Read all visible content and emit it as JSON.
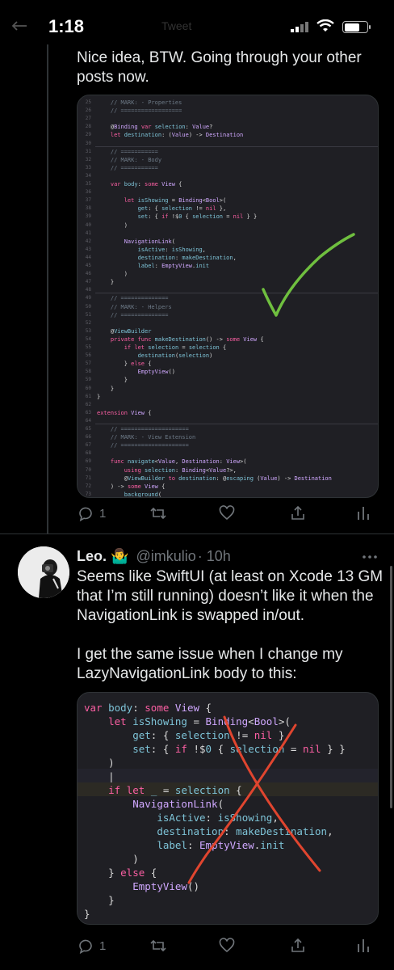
{
  "status_bar": {
    "time": "1:18",
    "ghost_label": "Tweet"
  },
  "tweet1": {
    "text_lines": [
      "Nice idea, BTW. Going through your other",
      "posts now."
    ],
    "image_alt": "Xcode screenshot of LazyNavigationLink code with a green checkmark",
    "code_lines": [
      {
        "n": "25",
        "t": "    // MARK: - Properties",
        "c": "cm"
      },
      {
        "n": "26",
        "t": "    // ==================",
        "c": "cm"
      },
      {
        "n": "27",
        "t": "",
        "c": "pl"
      },
      {
        "n": "28",
        "t": "    @Binding var selection: Value?",
        "c": "mix1"
      },
      {
        "n": "29",
        "t": "    let destination: (Value) -> Destination",
        "c": "mix2"
      },
      {
        "n": "30",
        "t": "",
        "c": "pl"
      },
      {
        "n": "31",
        "t": "    // ===========",
        "c": "cm"
      },
      {
        "n": "32",
        "t": "    // MARK: - Body",
        "c": "cm"
      },
      {
        "n": "33",
        "t": "    // ===========",
        "c": "cm"
      },
      {
        "n": "34",
        "t": "",
        "c": "pl"
      },
      {
        "n": "35",
        "t": "    var body: some View {",
        "c": "mix3"
      },
      {
        "n": "36",
        "t": "",
        "c": "pl"
      },
      {
        "n": "37",
        "t": "        let isShowing = Binding<Bool>(",
        "c": "mix4"
      },
      {
        "n": "38",
        "t": "            get: { selection != nil },",
        "c": "mix5"
      },
      {
        "n": "39",
        "t": "            set: { if !$0 { selection = nil } }",
        "c": "mix5"
      },
      {
        "n": "40",
        "t": "        )",
        "c": "pl"
      },
      {
        "n": "41",
        "t": "",
        "c": "pl"
      },
      {
        "n": "42",
        "t": "        NavigationLink(",
        "c": "ty"
      },
      {
        "n": "43",
        "t": "            isActive: isShowing,",
        "c": "ac"
      },
      {
        "n": "44",
        "t": "            destination: makeDestination,",
        "c": "ac"
      },
      {
        "n": "45",
        "t": "            label: EmptyView.init",
        "c": "ac"
      },
      {
        "n": "46",
        "t": "        )",
        "c": "pl"
      },
      {
        "n": "47",
        "t": "    }",
        "c": "pl"
      },
      {
        "n": "48",
        "t": "",
        "c": "pl"
      },
      {
        "n": "49",
        "t": "    // ==============",
        "c": "cm"
      },
      {
        "n": "50",
        "t": "    // MARK: - Helpers",
        "c": "cm"
      },
      {
        "n": "51",
        "t": "    // ==============",
        "c": "cm"
      },
      {
        "n": "52",
        "t": "",
        "c": "pl"
      },
      {
        "n": "53",
        "t": "    @ViewBuilder",
        "c": "at"
      },
      {
        "n": "54",
        "t": "    private func makeDestination() -> some View {",
        "c": "mix6"
      },
      {
        "n": "55",
        "t": "        if let selection = selection {",
        "c": "mix7"
      },
      {
        "n": "56",
        "t": "            destination(selection)",
        "c": "ac"
      },
      {
        "n": "57",
        "t": "        } else {",
        "c": "mix8"
      },
      {
        "n": "58",
        "t": "            EmptyView()",
        "c": "ty"
      },
      {
        "n": "59",
        "t": "        }",
        "c": "pl"
      },
      {
        "n": "60",
        "t": "    }",
        "c": "pl"
      },
      {
        "n": "61",
        "t": "}",
        "c": "pl"
      },
      {
        "n": "62",
        "t": "",
        "c": "pl"
      },
      {
        "n": "63",
        "t": "extension View {",
        "c": "mix9"
      },
      {
        "n": "64",
        "t": "",
        "c": "pl"
      },
      {
        "n": "65",
        "t": "    // ====================",
        "c": "cm"
      },
      {
        "n": "66",
        "t": "    // MARK: - View Extension",
        "c": "cm"
      },
      {
        "n": "67",
        "t": "    // ====================",
        "c": "cm"
      },
      {
        "n": "68",
        "t": "",
        "c": "pl"
      },
      {
        "n": "69",
        "t": "    func navigate<Value, Destination: View>(",
        "c": "mix10"
      },
      {
        "n": "70",
        "t": "        using selection: Binding<Value?>,",
        "c": "mix11"
      },
      {
        "n": "71",
        "t": "        @ViewBuilder to destination: @escaping (Value) -> Destination",
        "c": "mix12"
      },
      {
        "n": "72",
        "t": "    ) -> some View {",
        "c": "mix13"
      },
      {
        "n": "73",
        "t": "        background(",
        "c": "ac"
      }
    ],
    "actions": {
      "replies": "1",
      "retweets": "",
      "likes": ""
    }
  },
  "tweet2": {
    "author_name": "Leo.",
    "author_emoji": "🤷‍♂️",
    "handle": "@imkulio",
    "time": "· 10h",
    "text_lines": [
      "Seems like SwiftUI (at least on Xcode 13 GM",
      "that I’m still running) doesn’t like it when the",
      "NavigationLink is swapped in/out.",
      "",
      "I get the same issue when I change my",
      "LazyNavigationLink body to this:"
    ],
    "code_lines": [
      "var body: some View {",
      "    let isShowing = Binding<Bool>(",
      "        get: { selection != nil },",
      "        set: { if !$0 { selection = nil } }",
      "    )",
      "    |",
      "    if let _ = selection {",
      "        NavigationLink(",
      "            isActive: isShowing,",
      "            destination: makeDestination,",
      "            label: EmptyView.init",
      "        )",
      "    } else {",
      "        EmptyView()",
      "    }",
      "}"
    ],
    "actions": {
      "replies": "1",
      "retweets": "",
      "likes": ""
    }
  },
  "colors": {
    "background": "#000000",
    "text": "#e7e9ea",
    "secondary": "#71767b",
    "checkmark": "#6fbf3f",
    "cross": "#e0452f"
  }
}
